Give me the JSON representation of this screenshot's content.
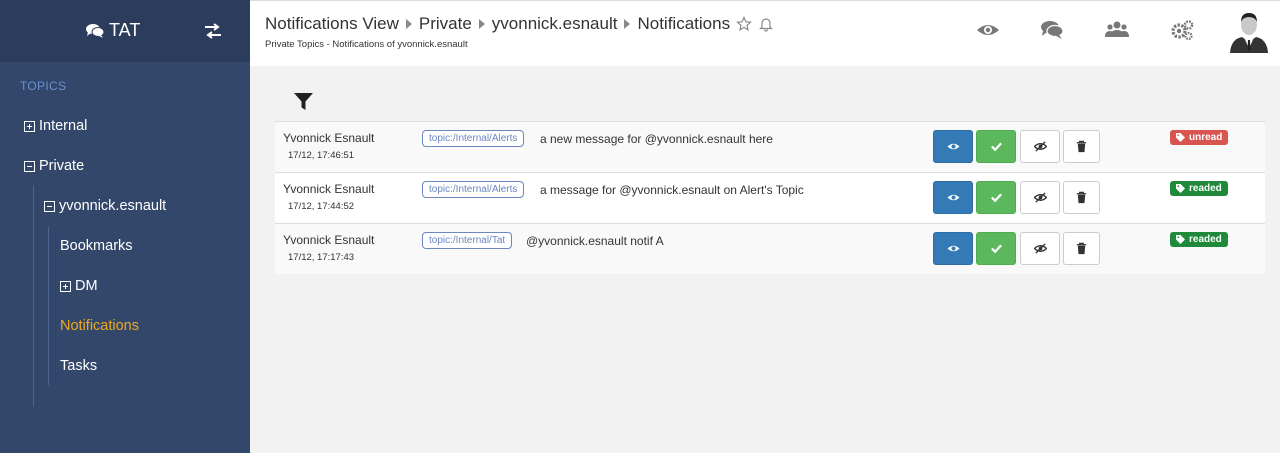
{
  "brand": {
    "name": "TAT"
  },
  "sidebar": {
    "section_label": "TOPICS",
    "items": [
      {
        "label": "Internal"
      },
      {
        "label": "Private"
      },
      {
        "label": "yvonnick.esnault"
      },
      {
        "label": "Bookmarks"
      },
      {
        "label": "DM"
      },
      {
        "label": "Notifications"
      },
      {
        "label": "Tasks"
      }
    ]
  },
  "header": {
    "breadcrumb": [
      "Notifications View",
      "Private",
      "yvonnick.esnault",
      "Notifications"
    ],
    "subtitle": "Private Topics - Notifications of yvonnick.esnault"
  },
  "notifications": [
    {
      "author": "Yvonnick Esnault",
      "time": "17/12, 17:46:51",
      "topic": "topic:/Internal/Alerts",
      "text": "a new message for @yvonnick.esnault here",
      "status": "unread",
      "status_color": "#d9534f"
    },
    {
      "author": "Yvonnick Esnault",
      "time": "17/12, 17:44:52",
      "topic": "topic:/Internal/Alerts",
      "text": "a message for @yvonnick.esnault on Alert's Topic",
      "status": "readed",
      "status_color": "#1e8a3a"
    },
    {
      "author": "Yvonnick Esnault",
      "time": "17/12, 17:17:43",
      "topic": "topic:/Internal/Tat",
      "text": "@yvonnick.esnault notif A",
      "status": "readed",
      "status_color": "#1e8a3a"
    }
  ],
  "colors": {
    "sidebar_bg": "#33476b",
    "active": "#f0a81f",
    "primary": "#337ab7",
    "success": "#5cb85c"
  },
  "icons": [
    "comments-icon",
    "swap-icon",
    "star-icon",
    "bell-icon",
    "eye-icon",
    "chat-icon",
    "users-icon",
    "gears-icon",
    "filter-icon",
    "check-icon",
    "eye-slash-icon",
    "trash-icon",
    "tag-icon"
  ]
}
